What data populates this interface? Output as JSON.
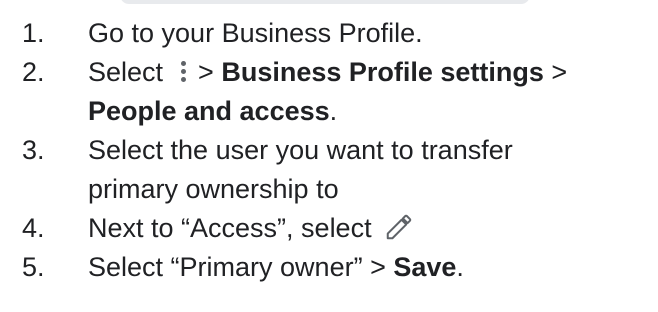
{
  "steps": [
    {
      "number": "1.",
      "text": "Go to your Business Profile."
    },
    {
      "number": "2.",
      "prefix": "Select ",
      "sep1": " > ",
      "bold1": "Business Profile settings",
      "sep2": " > ",
      "bold2": "People and access",
      "suffix": ".",
      "icon": "more-vert-icon"
    },
    {
      "number": "3.",
      "line1": "Select the user you want to transfer",
      "line2": "primary ownership to"
    },
    {
      "number": "4.",
      "text": "Next to “Access”, select",
      "icon": "edit-pencil-icon"
    },
    {
      "number": "5.",
      "prefix": "Select “Primary owner” > ",
      "bold": "Save",
      "suffix": "."
    }
  ]
}
